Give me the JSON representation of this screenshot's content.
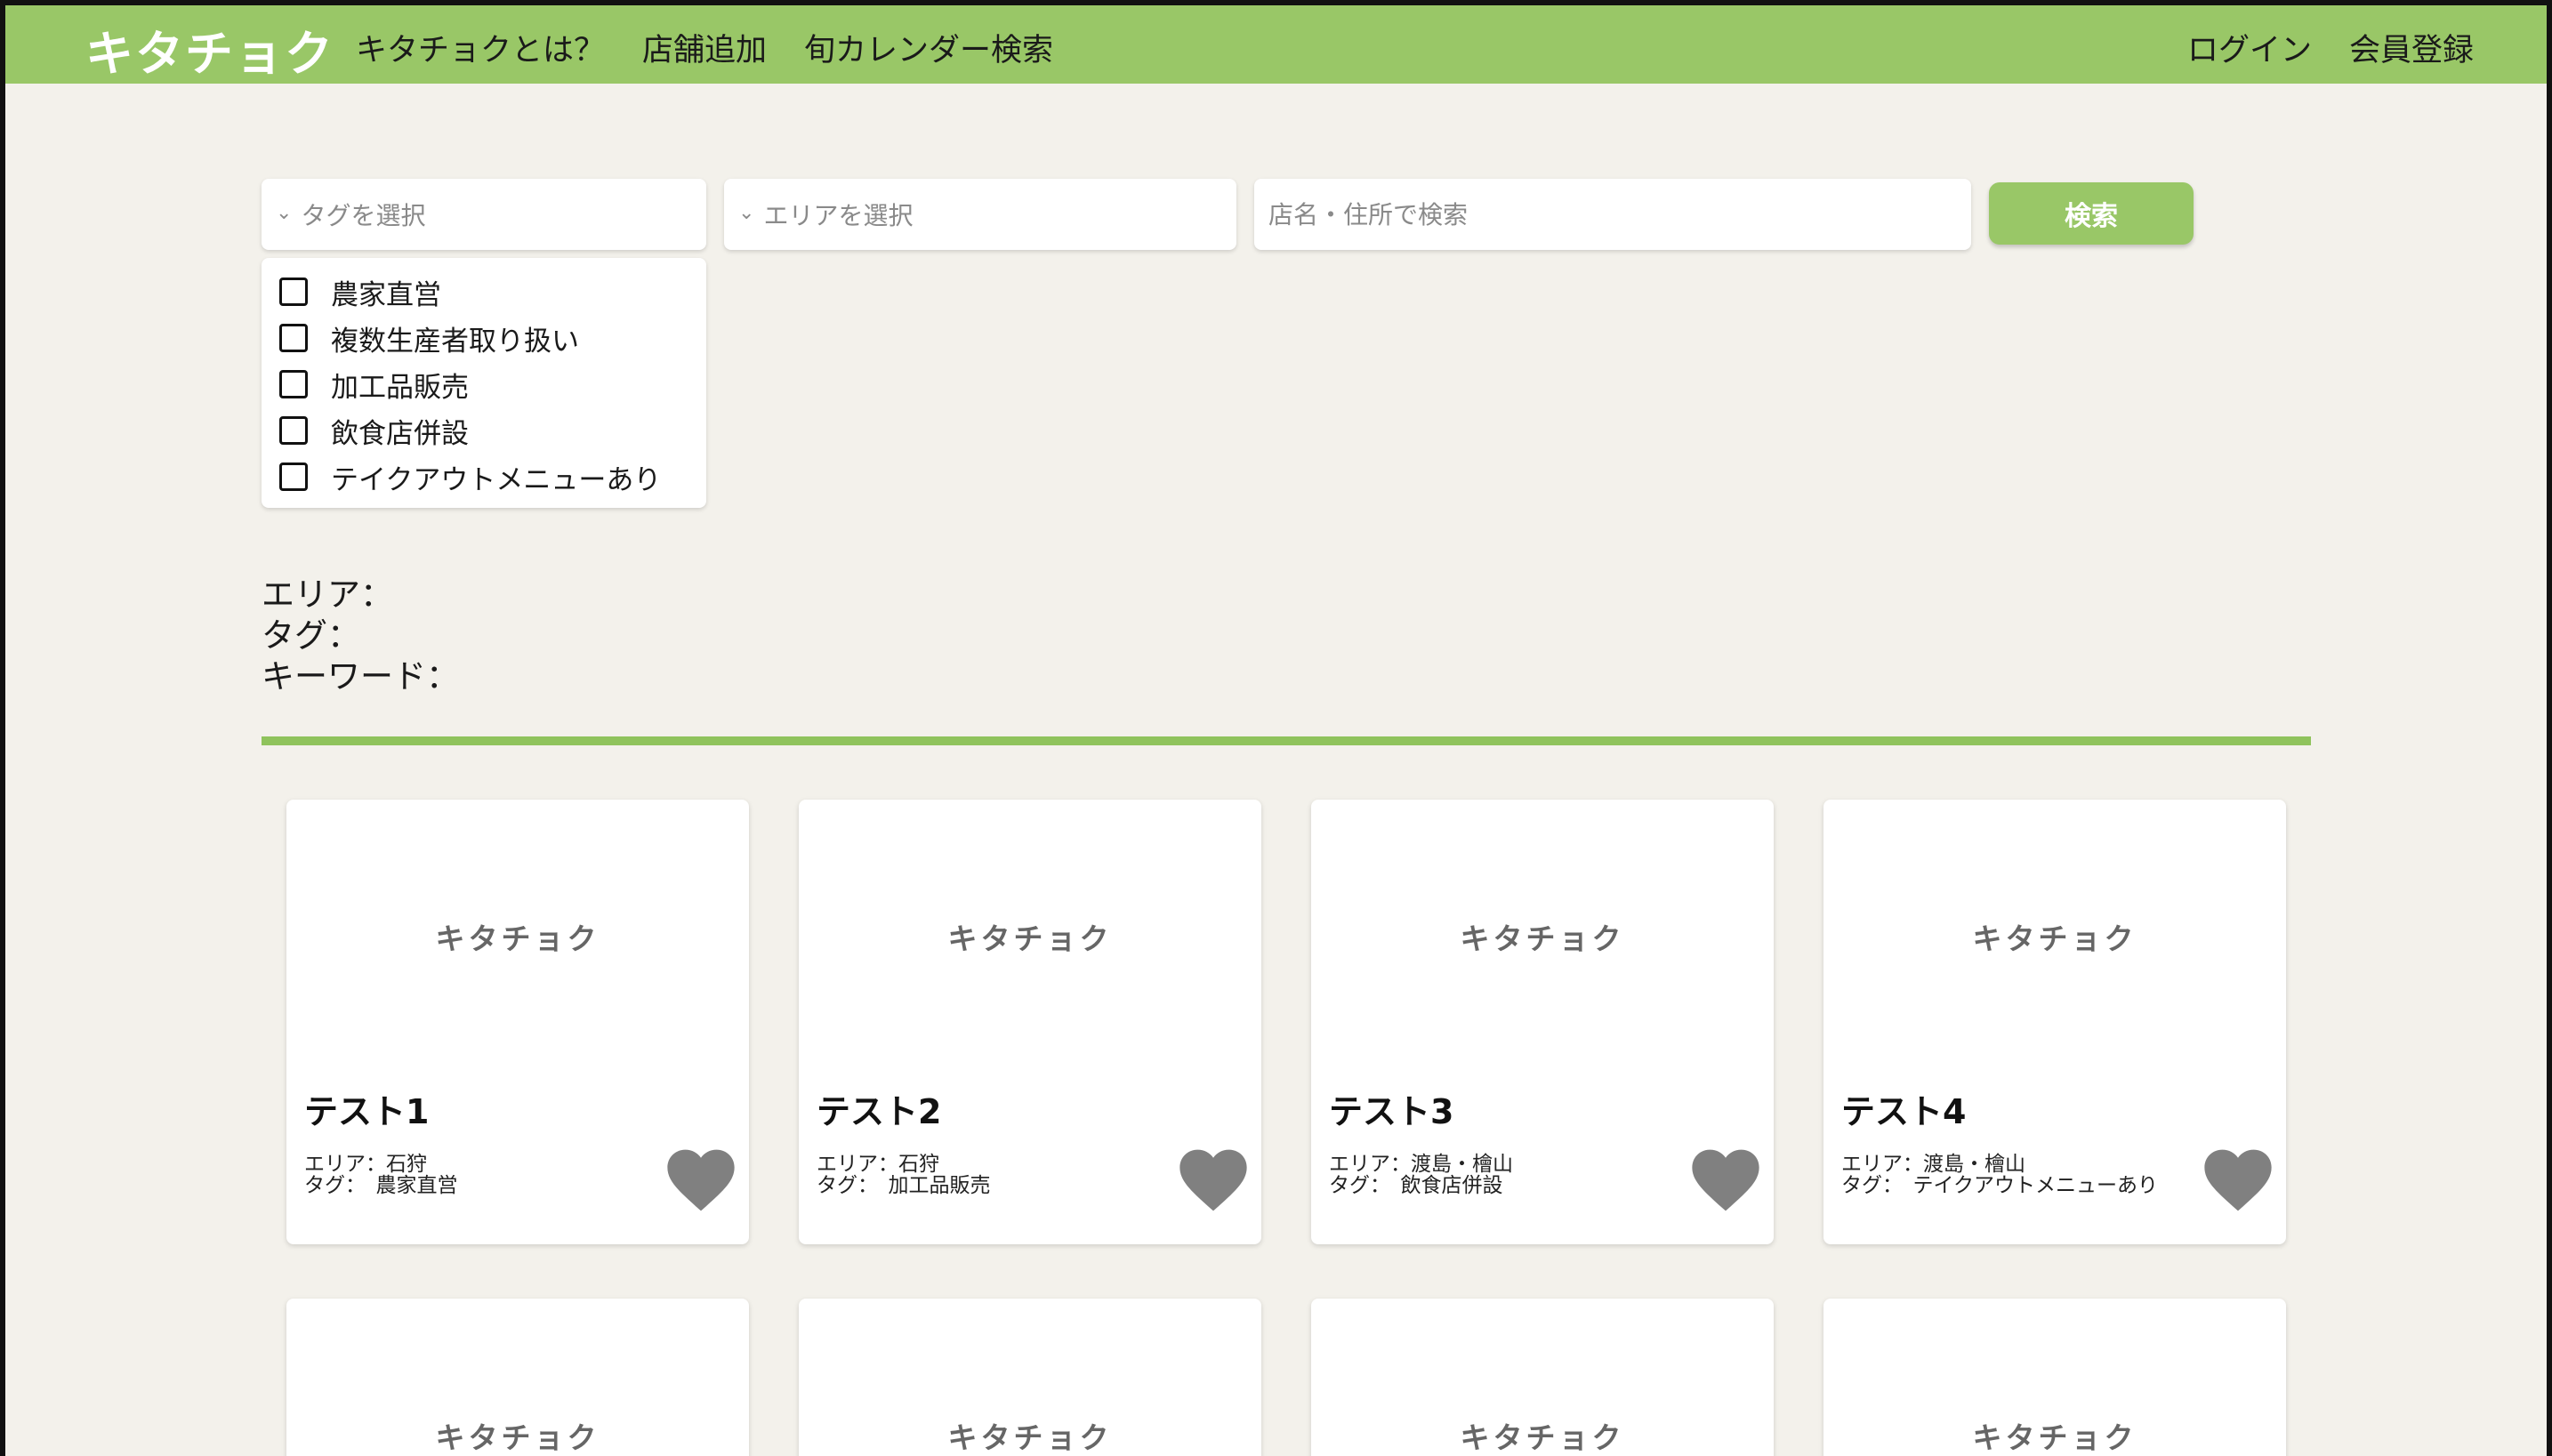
{
  "header": {
    "logo": "キタチョク",
    "nav_left": [
      "キタチョクとは？",
      "店舗追加",
      "旬カレンダー検索"
    ],
    "nav_right": [
      "ログイン",
      "会員登録"
    ]
  },
  "search": {
    "tag_placeholder": "タグを選択",
    "area_placeholder": "エリアを選択",
    "keyword_placeholder": "店名・住所で検索",
    "button_label": "検索"
  },
  "tag_options": [
    "農家直営",
    "複数生産者取り扱い",
    "加工品販売",
    "飲食店併設",
    "テイクアウトメニューあり"
  ],
  "conditions": {
    "area": "エリア：",
    "tag": "タグ：",
    "keyword": "キーワード："
  },
  "cards": [
    {
      "logo": "キタチョク",
      "title": "テスト1",
      "area": "エリア：石狩",
      "tag": "タグ：　農家直営"
    },
    {
      "logo": "キタチョク",
      "title": "テスト2",
      "area": "エリア：石狩",
      "tag": "タグ：　加工品販売"
    },
    {
      "logo": "キタチョク",
      "title": "テスト3",
      "area": "エリア：渡島・檜山",
      "tag": "タグ：　飲食店併設"
    },
    {
      "logo": "キタチョク",
      "title": "テスト4",
      "area": "エリア：渡島・檜山",
      "tag": "タグ：　テイクアウトメニューあり"
    }
  ],
  "cards_row2": [
    {
      "logo": "キタチョク"
    },
    {
      "logo": "キタチョク"
    },
    {
      "logo": "キタチョク"
    },
    {
      "logo": "キタチョク"
    }
  ],
  "colors": {
    "brand_green": "#99c767",
    "background": "#f3f1eb",
    "heart_gray": "#808080"
  }
}
